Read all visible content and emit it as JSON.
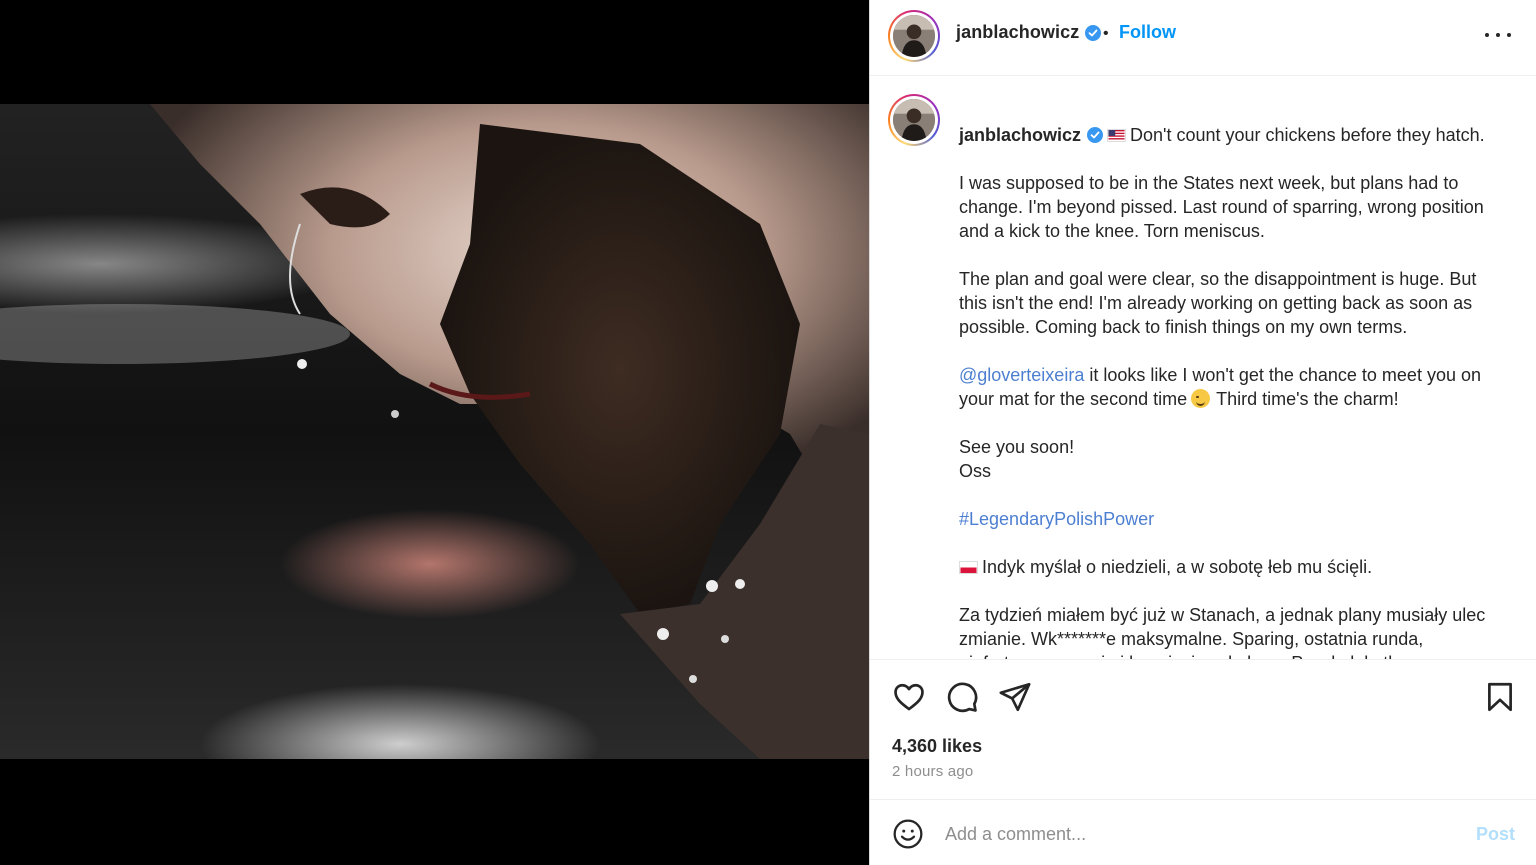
{
  "post": {
    "username": "janblachowicz",
    "verified": true,
    "follow_label": "Follow",
    "separator": "•",
    "more_icon": "more-horizontal-icon",
    "media_alt": "Close-up photo of a bearded fighter with sweat dripping"
  },
  "caption": {
    "username": "janblachowicz",
    "first_line": "Don't count your chickens before they hatch.",
    "p1": "I was supposed to be in the States next week, but plans had to change. I'm beyond pissed. Last round of sparring, wrong position and a kick to the knee. Torn meniscus.",
    "p2": "The plan and goal were clear, so the disappointment is huge. But this isn't the end! I'm already working on getting back as soon as possible. Coming back to finish things on my own terms.",
    "mention": "@gloverteixeira",
    "p3_rest": " it looks like I won't get the chance to meet you on your mat for the second time",
    "p3_end": "Third time's the charm!",
    "p4_line1": "See you soon!",
    "p4_line2": "Oss",
    "hashtag": "#LegendaryPolishPower",
    "pl_first_line": "Indyk myślał o niedzieli, a w sobotę łeb mu ścięli.",
    "pl_p1": "Za tydzień miałem być już w Stanach, a jednak plany musiały ulec zmianie. Wk*******e maksymalne. Sparing, ostatnia runda, niefortunna pozycja i kopnięcie w kolano. Poszła łąkotka."
  },
  "actions": {
    "like_icon": "heart-icon",
    "comment_icon": "comment-icon",
    "share_icon": "share-icon",
    "save_icon": "bookmark-icon",
    "likes": "4,360 likes",
    "time": "2 hours ago"
  },
  "comment": {
    "emoji_icon": "emoji-icon",
    "placeholder": "Add a comment...",
    "post_label": "Post"
  },
  "colors": {
    "link": "#0095f6",
    "mention": "#4d7fd1",
    "post_disabled": "#b2dffc",
    "muted": "#8e8e8e"
  }
}
